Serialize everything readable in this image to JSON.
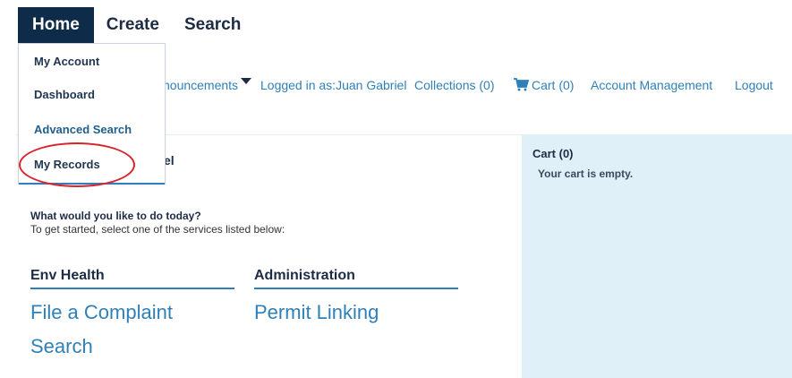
{
  "nav": {
    "tabs": [
      {
        "label": "Home"
      },
      {
        "label": "Create"
      },
      {
        "label": "Search"
      }
    ]
  },
  "home_menu": {
    "items": [
      {
        "label": "My Account"
      },
      {
        "label": "Dashboard"
      },
      {
        "label": "Advanced Search"
      },
      {
        "label": "My Records"
      }
    ]
  },
  "links": {
    "announcements": "nouncements",
    "logged_in": "Logged in as:Juan Gabriel",
    "collections": "Collections (0)",
    "cart": "Cart (0)",
    "account_management": "Account Management",
    "logout": "Logout"
  },
  "main": {
    "welcome_fragment": "el",
    "question": "What would you like to do today?",
    "hint": "To get started, select one of the services listed below:",
    "sections": [
      {
        "title": "Env Health",
        "links": [
          "File a Complaint",
          "Search"
        ]
      },
      {
        "title": "Administration",
        "links": [
          "Permit Linking"
        ]
      }
    ]
  },
  "cart": {
    "title": "Cart (0)",
    "empty_text": "Your cart is empty."
  },
  "colors": {
    "nav_active": "#0e2c49",
    "link_blue": "#2f80b8",
    "cart_bg": "#dff0f8",
    "highlight_red": "#d9242b"
  },
  "icons": {
    "cart": "shopping-cart-icon",
    "announcements_caret": "caret-down-icon"
  }
}
